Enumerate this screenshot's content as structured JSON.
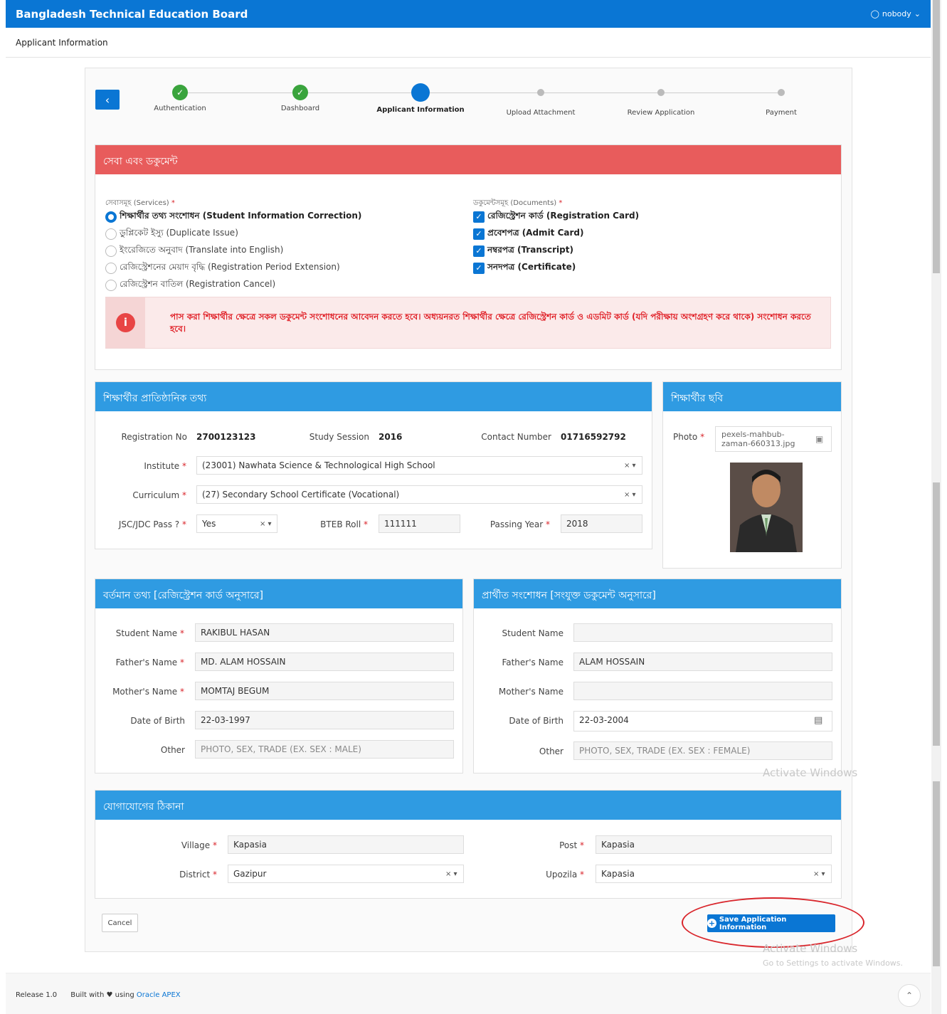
{
  "header": {
    "brand": "Bangladesh Technical Education Board",
    "user": "nobody"
  },
  "breadcrumb": "Applicant Information",
  "steps": [
    {
      "label": "Authentication",
      "state": "done"
    },
    {
      "label": "Dashboard",
      "state": "done"
    },
    {
      "label": "Applicant Information",
      "state": "current"
    },
    {
      "label": "Upload Attachment",
      "state": "todo"
    },
    {
      "label": "Review Application",
      "state": "todo"
    },
    {
      "label": "Payment",
      "state": "todo"
    }
  ],
  "services_panel": {
    "title": "সেবা এবং ডকুমেন্ট",
    "services_label": "সেবাসমূহ (Services)",
    "documents_label": "ডকুমেন্টসমূহ (Documents)",
    "services": [
      "শিক্ষার্থীর তথ্য সংশোধন (Student Information Correction)",
      "ডুপ্লিকেট ইস্যু (Duplicate Issue)",
      "ইংরেজিতে অনুবাদ (Translate into English)",
      "রেজিস্ট্রেশনের মেয়াদ বৃদ্ধি (Registration Period Extension)",
      "রেজিস্ট্রেশন বাতিল (Registration Cancel)"
    ],
    "selected_service": 0,
    "documents": [
      "রেজিস্ট্রেশন কার্ড (Registration Card)",
      "প্রবেশপত্র (Admit Card)",
      "নম্বরপত্র (Transcript)",
      "সনদপত্র (Certificate)"
    ],
    "alert": "পাস করা শিক্ষার্থীর ক্ষেত্রে সকল ডকুমেন্ট সংশোধনের আবেদন করতে হবে। অধ্যয়নরত শিক্ষার্থীর ক্ষেত্রে রেজিস্ট্রেশন কার্ড ও এডমিট কার্ড (যদি পরীক্ষায় অংশগ্রহণ করে থাকে) সংশোধন করতে হবে।"
  },
  "academic": {
    "title": "শিক্ষার্থীর প্রাতিষ্ঠানিক তথ্য",
    "reg_label": "Registration No",
    "reg_value": "2700123123",
    "session_label": "Study Session",
    "session_value": "2016",
    "contact_label": "Contact Number",
    "contact_value": "01716592792",
    "institute_label": "Institute",
    "institute_value": "(23001) Nawhata Science & Technological High School",
    "curriculum_label": "Curriculum",
    "curriculum_value": "(27) Secondary School Certificate (Vocational)",
    "jsc_label": "JSC/JDC Pass ?",
    "jsc_value": "Yes",
    "roll_label": "BTEB Roll",
    "roll_value": "111111",
    "year_label": "Passing Year",
    "year_value": "2018"
  },
  "photo": {
    "title": "শিক্ষার্থীর ছবি",
    "label": "Photo",
    "file_line1": "pexels-mahbub-",
    "file_line2": "zaman-660313.jpg"
  },
  "current": {
    "title": "বর্তমান তথ্য [রেজিস্ট্রেশন কার্ড অনুসারে]",
    "fields": [
      {
        "label": "Student Name",
        "value": "RAKIBUL HASAN"
      },
      {
        "label": "Father's Name",
        "value": "MD. ALAM HOSSAIN"
      },
      {
        "label": "Mother's Name",
        "value": "MOMTAJ BEGUM"
      },
      {
        "label": "Date of Birth",
        "value": "22-03-1997"
      },
      {
        "label": "Other",
        "value": "PHOTO, SEX, TRADE (EX. SEX : MALE)"
      }
    ]
  },
  "requested": {
    "title": "প্রার্থীত সংশোধন [সংযুক্ত ডকুমেন্ট অনুসারে]",
    "fields": [
      {
        "label": "Student Name",
        "value": ""
      },
      {
        "label": "Father's Name",
        "value": "ALAM HOSSAIN"
      },
      {
        "label": "Mother's Name",
        "value": ""
      },
      {
        "label": "Date of Birth",
        "value": "22-03-2004"
      },
      {
        "label": "Other",
        "value": "PHOTO, SEX, TRADE (EX. SEX : FEMALE)"
      }
    ]
  },
  "address": {
    "title": "যোগাযোগের ঠিকানা",
    "village_label": "Village",
    "village_value": "Kapasia",
    "post_label": "Post",
    "post_value": "Kapasia",
    "district_label": "District",
    "district_value": "Gazipur",
    "upozila_label": "Upozila",
    "upozila_value": "Kapasia"
  },
  "actions": {
    "cancel": "Cancel",
    "save": "Save Application Information"
  },
  "watermark": {
    "title": "Activate Windows",
    "sub": "Go to Settings to activate Windows."
  },
  "footer": {
    "release": "Release 1.0",
    "built": "Built with",
    "using": "using",
    "apex": "Oracle APEX"
  }
}
